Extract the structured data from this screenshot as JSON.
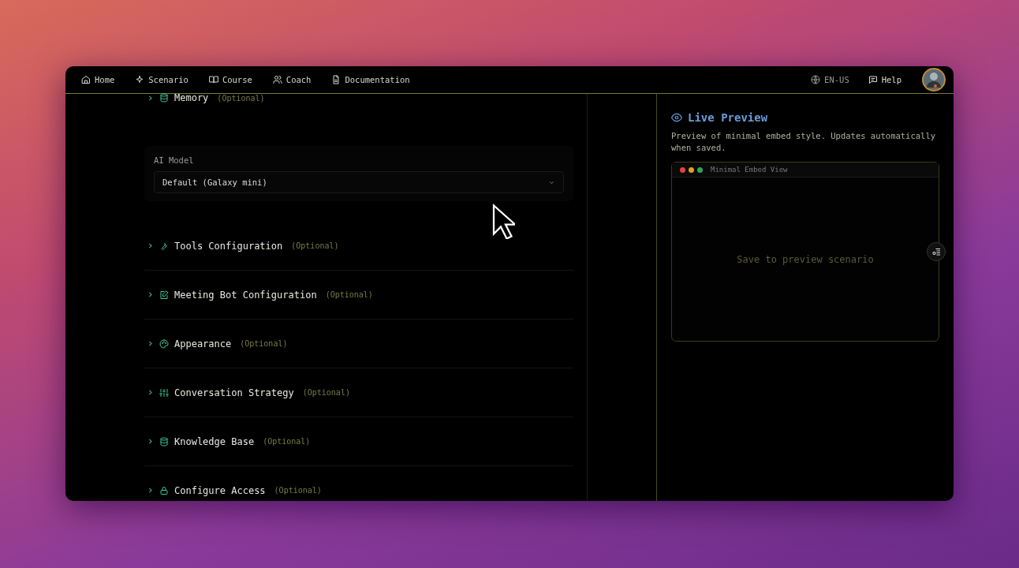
{
  "nav": {
    "items": [
      {
        "label": "Home"
      },
      {
        "label": "Scenario"
      },
      {
        "label": "Course"
      },
      {
        "label": "Coach"
      },
      {
        "label": "Documentation"
      }
    ],
    "language": "EN-US",
    "help": "Help"
  },
  "memory": {
    "title": "Memory",
    "note": "(Optional)"
  },
  "ai_model": {
    "label": "AI Model",
    "value": "Default (Galaxy mini)"
  },
  "sections": [
    {
      "title": "Tools Configuration",
      "note": "(Optional)"
    },
    {
      "title": "Meeting Bot Configuration",
      "note": "(Optional)"
    },
    {
      "title": "Appearance",
      "note": "(Optional)"
    },
    {
      "title": "Conversation Strategy",
      "note": "(Optional)"
    },
    {
      "title": "Knowledge Base",
      "note": "(Optional)"
    },
    {
      "title": "Configure Access",
      "note": "(Optional)"
    }
  ],
  "preview": {
    "title": "Live Preview",
    "description": "Preview of minimal embed style. Updates automatically when saved.",
    "window_title": "Minimal Embed View",
    "empty_text": "Save to preview scenario"
  }
}
